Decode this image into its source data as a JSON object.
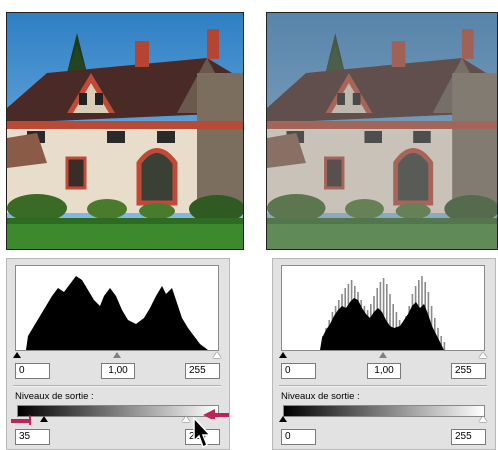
{
  "photos": {
    "before": {
      "icon": "house-photo-original"
    },
    "after": {
      "icon": "house-photo-low-contrast"
    }
  },
  "levels_left": {
    "input_shadow": "0",
    "input_gamma": "1,00",
    "input_highlight": "255",
    "output_label": "Niveaux de sortie :",
    "output_shadow": "35",
    "output_highlight": "215",
    "output_shadow_level": 0.137,
    "output_highlight_level": 0.843
  },
  "levels_right": {
    "input_shadow": "0",
    "input_gamma": "1,00",
    "input_highlight": "255",
    "output_label": "Niveaux de sortie :",
    "output_shadow": "0",
    "output_highlight": "255",
    "output_shadow_level": 0,
    "output_highlight_level": 1
  },
  "colors": {
    "panel_bg": "#e2e2e2",
    "arrow": "#c0235a",
    "sky": "#3f8fcf",
    "grass": "#3d8a2e",
    "roof": "#4a2a26",
    "brick": "#c04a35",
    "wall": "#e8dccb"
  }
}
